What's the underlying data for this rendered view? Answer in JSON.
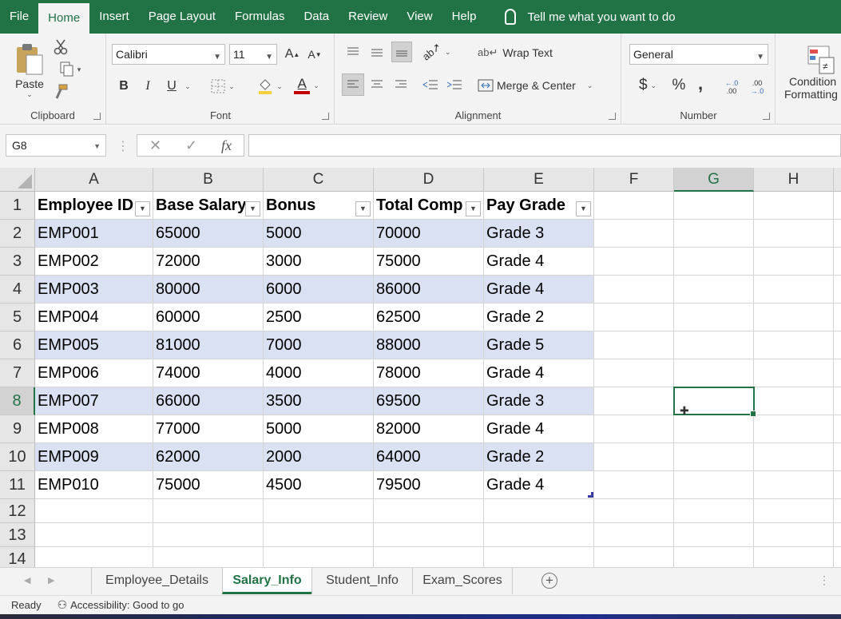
{
  "menu": {
    "items": [
      "File",
      "Home",
      "Insert",
      "Page Layout",
      "Formulas",
      "Data",
      "Review",
      "View",
      "Help"
    ],
    "active_index": 1,
    "tell_me": "Tell me what you want to do"
  },
  "ribbon": {
    "clipboard": {
      "paste": "Paste",
      "label": "Clipboard"
    },
    "font": {
      "name": "Calibri",
      "size": "11",
      "grow": "A",
      "shrink": "A",
      "bold": "B",
      "italic": "I",
      "underline": "U",
      "label": "Font"
    },
    "alignment": {
      "wrap_text": "Wrap Text",
      "merge_center": "Merge & Center",
      "label": "Alignment"
    },
    "number": {
      "format": "General",
      "currency": "$",
      "percent": "%",
      "comma": ",",
      "inc_decimal_top": "←.0",
      "inc_decimal_bottom": ".00",
      "dec_decimal_top": ".00",
      "dec_decimal_bottom": "→.0",
      "label": "Number"
    },
    "styles": {
      "conditional_line1": "Condition",
      "conditional_line2": "Formatting"
    }
  },
  "formula_bar": {
    "name_box": "G8",
    "fx": "fx",
    "value": ""
  },
  "columns": [
    "A",
    "B",
    "C",
    "D",
    "E",
    "F",
    "G",
    "H"
  ],
  "selected_column": "G",
  "rows": [
    "1",
    "2",
    "3",
    "4",
    "5",
    "6",
    "7",
    "8",
    "9",
    "10",
    "11",
    "12",
    "13",
    "14"
  ],
  "selected_row": "8",
  "table": {
    "headers": [
      "Employee ID",
      "Base Salary",
      "Bonus",
      "Total Comp",
      "Pay Grade"
    ],
    "rows": [
      [
        "EMP001",
        "65000",
        "5000",
        "70000",
        "Grade 3"
      ],
      [
        "EMP002",
        "72000",
        "3000",
        "75000",
        "Grade 4"
      ],
      [
        "EMP003",
        "80000",
        "6000",
        "86000",
        "Grade 4"
      ],
      [
        "EMP004",
        "60000",
        "2500",
        "62500",
        "Grade 2"
      ],
      [
        "EMP005",
        "81000",
        "7000",
        "88000",
        "Grade 5"
      ],
      [
        "EMP006",
        "74000",
        "4000",
        "78000",
        "Grade 4"
      ],
      [
        "EMP007",
        "66000",
        "3500",
        "69500",
        "Grade 3"
      ],
      [
        "EMP008",
        "77000",
        "5000",
        "82000",
        "Grade 4"
      ],
      [
        "EMP009",
        "62000",
        "2000",
        "64000",
        "Grade 2"
      ],
      [
        "EMP010",
        "75000",
        "4500",
        "79500",
        "Grade 4"
      ]
    ],
    "band_color": "#d9e1f2"
  },
  "sheets": {
    "tabs": [
      "Employee_Details",
      "Salary_Info",
      "Student_Info",
      "Exam_Scores"
    ],
    "active": "Salary_Info",
    "add": "+"
  },
  "status": {
    "ready": "Ready",
    "accessibility": "Accessibility: Good to go"
  },
  "colors": {
    "accent": "#217346"
  }
}
